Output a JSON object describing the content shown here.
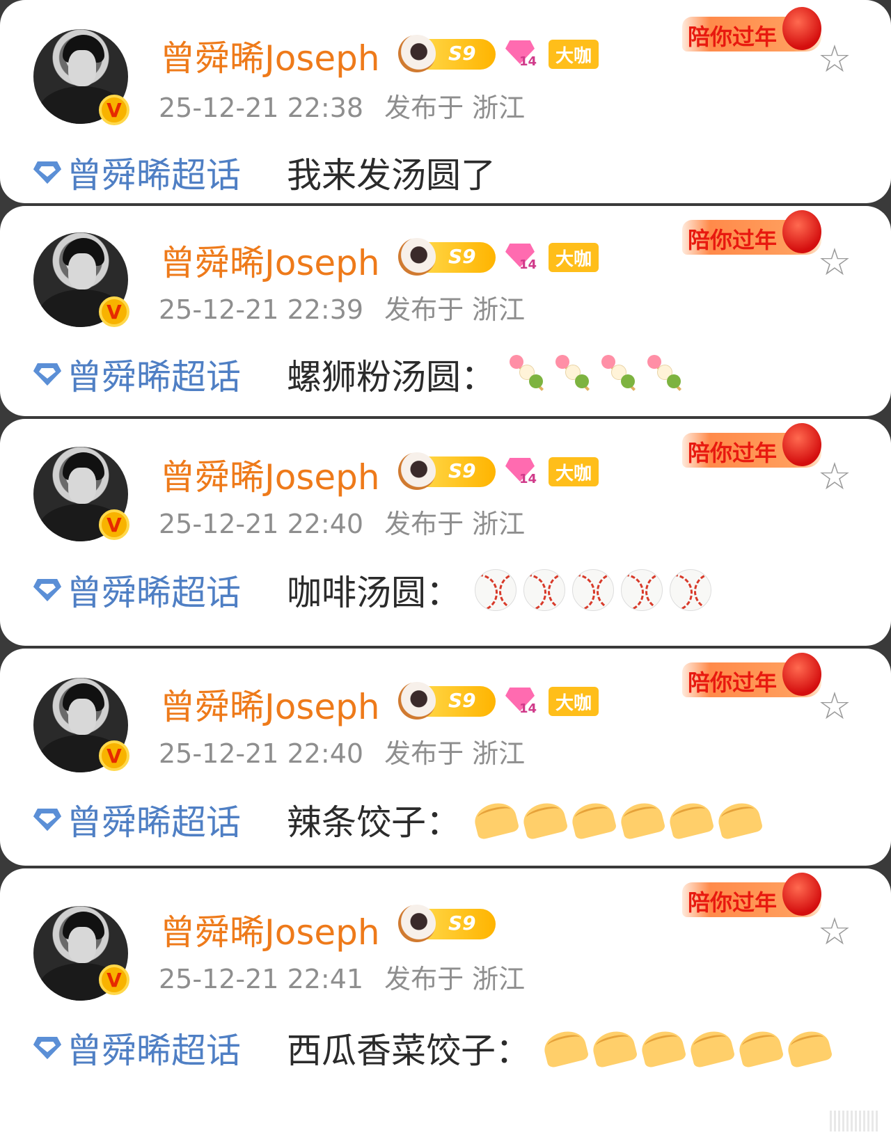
{
  "posts": [
    {
      "username": "曾舜晞Joseph",
      "level_badge": "S9",
      "gem_badge": "14",
      "show_gem": true,
      "role_badge": "大咖",
      "timestamp": "25-12-21 22:38",
      "location": "发布于 浙江",
      "festival_badge": "陪你过年",
      "topic": "曾舜晞超话",
      "text": "我来发汤圆了",
      "emoji_type": "",
      "emoji_count": 0
    },
    {
      "username": "曾舜晞Joseph",
      "level_badge": "S9",
      "gem_badge": "14",
      "show_gem": true,
      "role_badge": "大咖",
      "timestamp": "25-12-21 22:39",
      "location": "发布于 浙江",
      "festival_badge": "陪你过年",
      "topic": "曾舜晞超话",
      "text": "螺狮粉汤圆：",
      "emoji_type": "dango-icon",
      "emoji_count": 4
    },
    {
      "username": "曾舜晞Joseph",
      "level_badge": "S9",
      "gem_badge": "14",
      "show_gem": true,
      "role_badge": "大咖",
      "timestamp": "25-12-21 22:40",
      "location": "发布于 浙江",
      "festival_badge": "陪你过年",
      "topic": "曾舜晞超话",
      "text": "咖啡汤圆：",
      "emoji_type": "baseball-icon",
      "emoji_count": 5
    },
    {
      "username": "曾舜晞Joseph",
      "level_badge": "S9",
      "gem_badge": "14",
      "show_gem": true,
      "role_badge": "大咖",
      "timestamp": "25-12-21 22:40",
      "location": "发布于 浙江",
      "festival_badge": "陪你过年",
      "topic": "曾舜晞超话",
      "text": "辣条饺子：",
      "emoji_type": "dumpling-icon",
      "emoji_count": 6
    },
    {
      "username": "曾舜晞Joseph",
      "level_badge": "S9",
      "gem_badge": "",
      "show_gem": false,
      "role_badge": "",
      "timestamp": "25-12-21 22:41",
      "location": "发布于 浙江",
      "festival_badge": "陪你过年",
      "topic": "曾舜晞超话",
      "text": "西瓜香菜饺子：",
      "emoji_type": "dumpling-icon",
      "emoji_count": 6
    }
  ],
  "colors": {
    "username": "#ee7a1a",
    "topic": "#4f7fc4",
    "meta": "#8e8e8e",
    "text": "#2b2b2b"
  }
}
